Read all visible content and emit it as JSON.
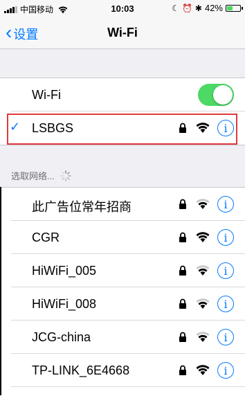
{
  "status_bar": {
    "carrier": "中国移动",
    "time": "10:03",
    "battery_pct": "42%",
    "battery_level": 0.42,
    "battery_color": "#4cd964"
  },
  "nav": {
    "back_label": "设置",
    "title": "Wi-Fi"
  },
  "wifi_toggle": {
    "label": "Wi-Fi",
    "on": true
  },
  "connected": {
    "name": "LSBGS",
    "icons": [
      "checkmark-icon",
      "lock-icon",
      "wifi-icon",
      "info-icon"
    ]
  },
  "section_header": "选取网络...",
  "networks": [
    {
      "name": "此广告位常年招商",
      "locked": true,
      "signal": 2
    },
    {
      "name": "CGR",
      "locked": true,
      "signal": 3
    },
    {
      "name": "HiWiFi_005",
      "locked": true,
      "signal": 2
    },
    {
      "name": "HiWiFi_008",
      "locked": true,
      "signal": 2
    },
    {
      "name": "JCG-china",
      "locked": true,
      "signal": 2
    },
    {
      "name": "TP-LINK_6E4668",
      "locked": true,
      "signal": 3
    }
  ],
  "colors": {
    "accent": "#007aff",
    "toggle_on": "#4cd964",
    "highlight": "#e0393e"
  }
}
